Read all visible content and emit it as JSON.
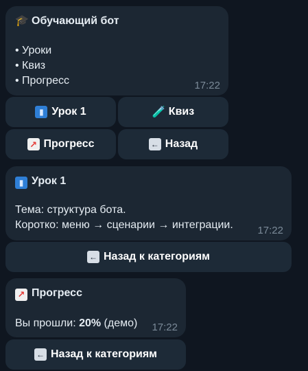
{
  "msg1": {
    "title_emoji": "🎓",
    "title": "Обучающий бот",
    "lines": [
      "• Уроки",
      "• Квиз",
      "• Прогресс"
    ],
    "time": "17:22",
    "buttons": [
      {
        "emoji": "📘",
        "label": "Урок 1"
      },
      {
        "emoji": "🧪",
        "label": "Квиз"
      },
      {
        "emoji": "📈",
        "label": "Прогресс"
      },
      {
        "emoji": "⬅",
        "label": "Назад"
      }
    ]
  },
  "msg2": {
    "title_emoji": "📘",
    "title": "Урок 1",
    "lines": [
      "Тема: структура бота.",
      "Коротко: меню → сценарии → интеграции."
    ],
    "time": "17:22",
    "button": {
      "emoji": "⬅",
      "label": "Назад к категориям"
    }
  },
  "msg3": {
    "title_emoji": "📈",
    "title": "Прогресс",
    "line_prefix": "Вы прошли: ",
    "line_value": "20%",
    "line_suffix": " (демо)",
    "time": "17:22",
    "button": {
      "emoji": "⬅",
      "label": "Назад к категориям"
    }
  }
}
